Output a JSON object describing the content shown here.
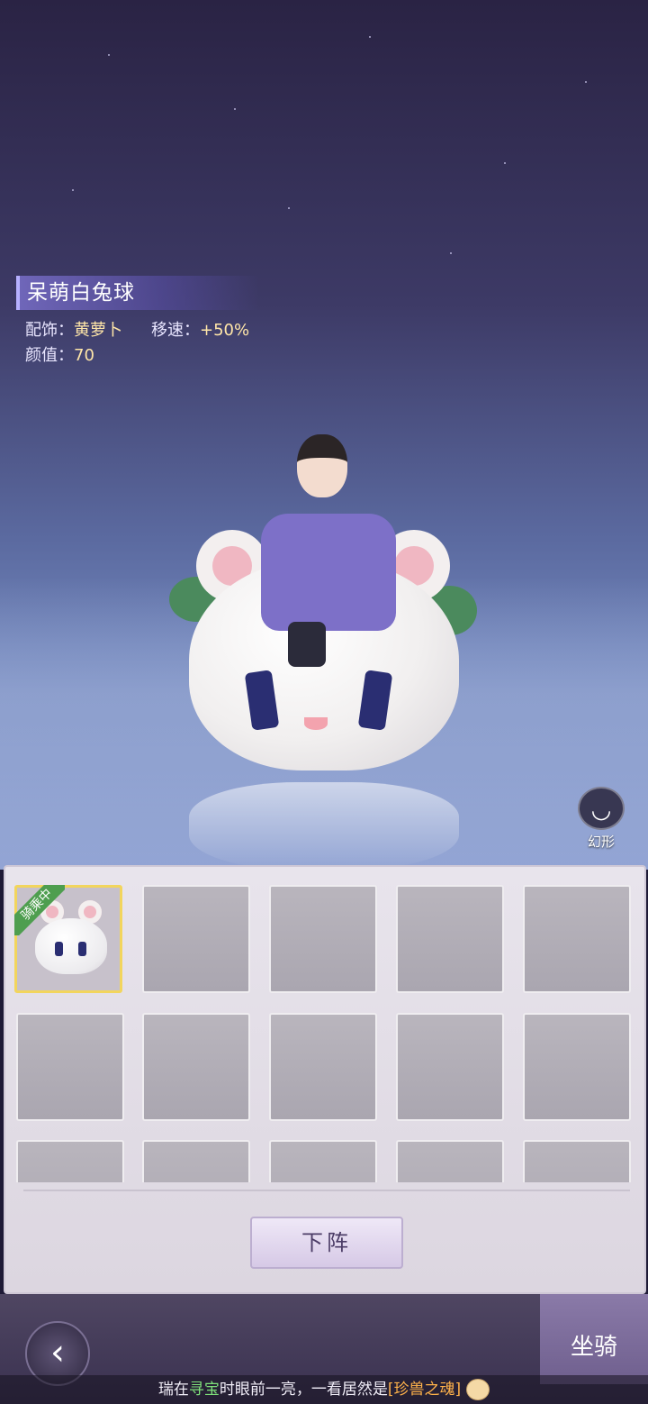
{
  "mount": {
    "name": "呆萌白兔球",
    "accessory_label": "配饰：",
    "accessory_value": "黄萝卜",
    "speed_label": "移速：",
    "speed_value": "+50%",
    "beauty_label": "颜值：",
    "beauty_value": "70"
  },
  "morph_button": {
    "label": "幻形",
    "icon": "morph-icon"
  },
  "grid": {
    "active_badge": "骑乘中",
    "slots_visible": 15
  },
  "unmount_button": {
    "label": "下阵"
  },
  "bottom_bar": {
    "back_icon": "back-arrow-icon",
    "tab_label": "坐骑"
  },
  "ticker": {
    "prefix": "瑞在",
    "highlight1": "寻宝",
    "middle": "时眼前一亮，一看居然是",
    "highlight2": "[珍兽之魂]",
    "icon": "treasure-face-icon"
  },
  "colors": {
    "active_border": "#f2d55d",
    "badge_green": "#4e9e4f",
    "stat_value": "#ffe6a8",
    "ticker_green": "#7ee07a",
    "ticker_orange": "#ffb24a"
  }
}
